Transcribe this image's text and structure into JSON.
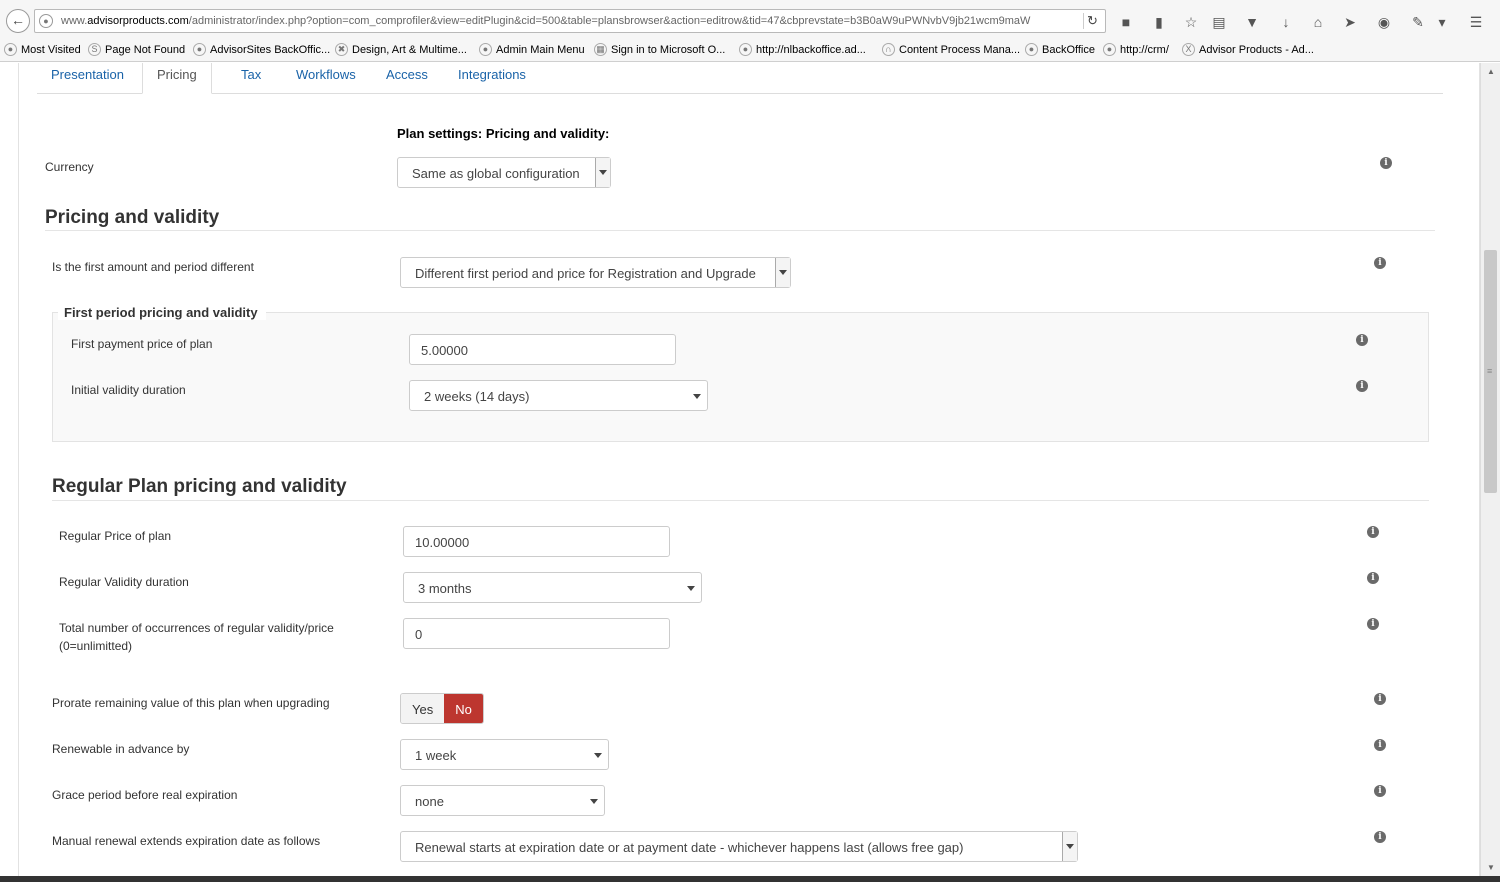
{
  "browser": {
    "url_prefix": "www.",
    "url_domain": "advisorproducts.com",
    "url_path": "/administrator/index.php?option=com_comprofiler&view=editPlugin&cid=500&table=plansbrowser&action=editrow&tid=47&cbprevstate=b3B0aW9uPWNvbV9jb21wcm9maW",
    "bookmarks": [
      {
        "label": "Most Visited"
      },
      {
        "label": "Page Not Found"
      },
      {
        "label": "AdvisorSites BackOffic..."
      },
      {
        "label": "Design, Art & Multime..."
      },
      {
        "label": "Admin Main Menu"
      },
      {
        "label": "Sign in to Microsoft O..."
      },
      {
        "label": "http://nlbackoffice.ad..."
      },
      {
        "label": "Content Process Mana..."
      },
      {
        "label": "BackOffice"
      },
      {
        "label": "http://crm/"
      },
      {
        "label": "Advisor Products - Ad..."
      }
    ]
  },
  "tabs": [
    {
      "label": "Presentation"
    },
    {
      "label": "Pricing"
    },
    {
      "label": "Tax"
    },
    {
      "label": "Workflows"
    },
    {
      "label": "Access"
    },
    {
      "label": "Integrations"
    }
  ],
  "plan_settings_heading": "Plan settings: Pricing and validity:",
  "currency": {
    "label": "Currency",
    "value": "Same as global configuration"
  },
  "pricing_heading": "Pricing and validity",
  "first_different": {
    "label": "Is the first amount and period different",
    "value": "Different first period and price for Registration and Upgrade"
  },
  "first_period": {
    "heading": "First period pricing and validity",
    "price_label": "First payment price of plan",
    "price_value": "5.00000",
    "duration_label": "Initial validity duration",
    "duration_value": "2 weeks (14 days)"
  },
  "regular_heading": "Regular Plan pricing and validity",
  "regular": {
    "price_label": "Regular Price of plan",
    "price_value": "10.00000",
    "duration_label": "Regular Validity duration",
    "duration_value": "3 months",
    "occurrences_label_1": "Total number of occurrences of regular validity/price",
    "occurrences_label_2": "(0=unlimitted)",
    "occurrences_value": "0"
  },
  "prorate": {
    "label": "Prorate remaining value of this plan when upgrading",
    "yes": "Yes",
    "no": "No",
    "selected": "No"
  },
  "renewable": {
    "label": "Renewable in advance by",
    "value": "1 week"
  },
  "grace": {
    "label": "Grace period before real expiration",
    "value": "none"
  },
  "manual_renewal": {
    "label": "Manual renewal extends expiration date as follows",
    "value": "Renewal starts at expiration date or at payment date - whichever happens last (allows free gap)"
  },
  "colors": {
    "link": "#1a63a8",
    "no_active": "#bd362f"
  }
}
